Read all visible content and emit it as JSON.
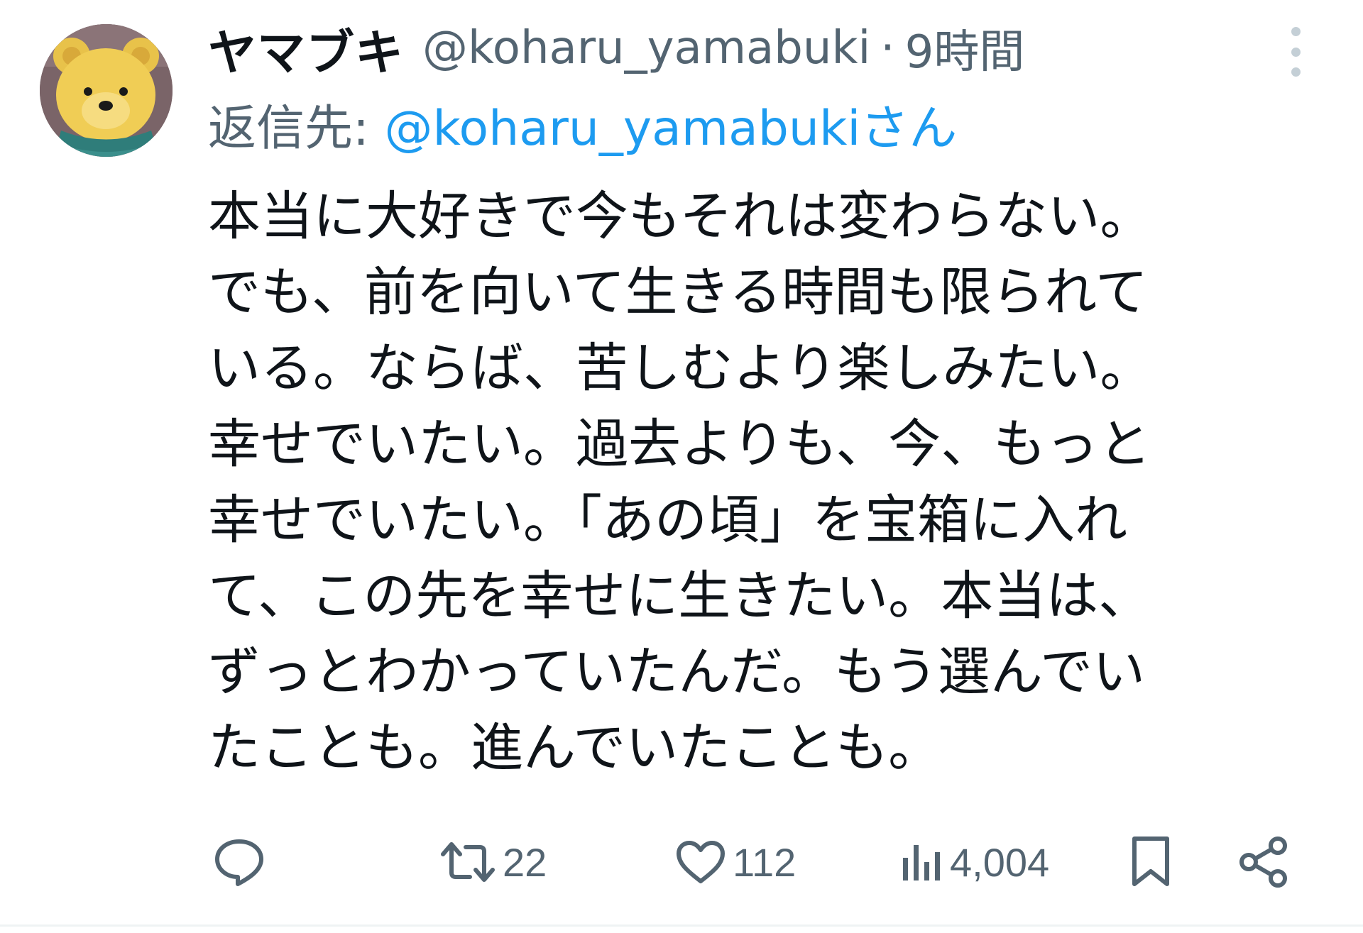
{
  "author": {
    "display_name": "ヤマブキ",
    "handle": "@koharu_yamabuki",
    "separator": "·",
    "time": "9時間"
  },
  "reply": {
    "prefix": "返信先: ",
    "target": "@koharu_yamabuki",
    "suffix": "さん"
  },
  "body_lines": [
    "本当に大好きで今もそれは変わらない。",
    "でも、前を向いて生きる時間も限られて",
    "いる。ならば、苦しむより楽しみたい。",
    "幸せでいたい。過去よりも、今、もっと",
    "幸せでいたい。「あの頃」を宝箱に入れ",
    "て、この先を幸せに生きたい。本当は、",
    "ずっとわかっていたんだ。もう選んでい",
    "たことも。進んでいたことも。"
  ],
  "actions": {
    "reply_icon": "reply-icon",
    "retweet_count": "22",
    "like_count": "112",
    "views_count": "4,004",
    "bookmark_icon": "bookmark-icon",
    "share_icon": "share-icon"
  },
  "colors": {
    "text": "#0f1419",
    "secondary": "#536471",
    "link": "#1d9bf0",
    "divider": "#eff3f4"
  }
}
